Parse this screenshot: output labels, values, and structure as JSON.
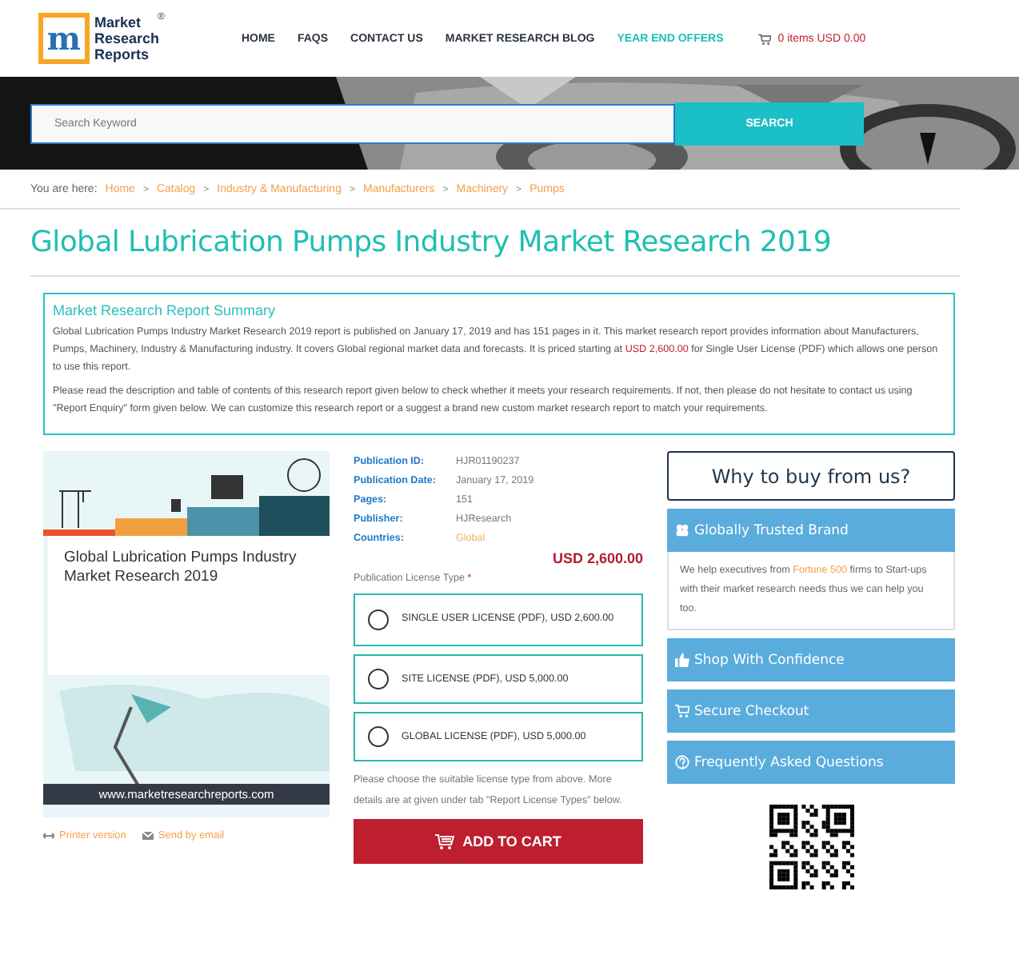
{
  "logo": {
    "letter": "m",
    "lines": [
      "Market",
      "Research",
      "Reports"
    ],
    "mark": "®"
  },
  "nav": [
    {
      "label": "HOME",
      "kind": "plain"
    },
    {
      "label": "FAQS",
      "kind": "plain"
    },
    {
      "label": "CONTACT US",
      "kind": "plain"
    },
    {
      "label": "MARKET RESEARCH BLOG",
      "kind": "plain"
    },
    {
      "label": "YEAR END OFFERS",
      "kind": "offer"
    }
  ],
  "cart": {
    "label": "0 items USD 0.00"
  },
  "search": {
    "placeholder": "Search Keyword",
    "button": "SEARCH"
  },
  "breadcrumb": {
    "prefix": "You are here:",
    "items": [
      "Home",
      "Catalog",
      "Industry & Manufacturing",
      "Manufacturers",
      "Machinery",
      "Pumps"
    ],
    "separator": ">"
  },
  "title": "Global Lubrication Pumps Industry Market Research 2019",
  "summary": {
    "heading": "Market Research Report Summary",
    "paragraphs": [
      [
        {
          "text": "Global Lubrication Pumps Industry Market Research 2019 report is published on January 17, 2019 and has 151 pages in it. This market research report provides information about Manufacturers, Pumps, Machinery, Industry & Manufacturing industry. It covers Global regional market data and forecasts. It is priced starting at ",
          "kind": "plain"
        },
        {
          "text": "USD 2,600.00",
          "kind": "price"
        },
        {
          "text": " for Single User License (PDF) which allows one person to use this report.",
          "kind": "plain"
        }
      ],
      [
        {
          "text": "Please read the description and table of contents of this research report given below to check whether it meets your research requirements. If not, then please do not hesitate to contact us using \"Report Enquiry\" form given below. We can customize this research report or a suggest a brand new custom market research report to match your requirements.",
          "kind": "plain"
        }
      ]
    ]
  },
  "cover": {
    "title": "Global Lubrication Pumps Industry Market Research 2019",
    "url": "www.marketresearchreports.com"
  },
  "links": [
    {
      "label": "Printer version",
      "kind": "print"
    },
    {
      "label": "Send by email",
      "kind": "email"
    }
  ],
  "details": [
    {
      "label": "Publication ID:",
      "value": "HJR01190237",
      "kind": "plain"
    },
    {
      "label": "Publication Date:",
      "value": "January 17, 2019",
      "kind": "plain"
    },
    {
      "label": "Pages:",
      "value": "151",
      "kind": "plain"
    },
    {
      "label": "Publisher:",
      "value": "HJResearch",
      "kind": "plain"
    },
    {
      "label": "Countries:",
      "value": "Global",
      "kind": "link"
    }
  ],
  "price": "USD 2,600.00",
  "license_label": "Publication License Type",
  "required_mark": "*",
  "licenses": [
    {
      "label": "SINGLE USER LICENSE (PDF), USD 2,600.00",
      "selected": false
    },
    {
      "label": "SITE LICENSE (PDF), USD 5,000.00",
      "selected": false
    },
    {
      "label": "GLOBAL LICENSE (PDF), USD 5,000.00",
      "selected": false
    }
  ],
  "license_note": "Please choose the suitable license type from above. More details are at given under tab \"Report License Types\" below.",
  "add_to_cart": "ADD TO CART",
  "why": {
    "heading": "Why to buy from us?",
    "items": [
      {
        "label": "Globally Trusted Brand",
        "kind": "brand",
        "body": [
          {
            "text": "We help executives from ",
            "kind": "plain"
          },
          {
            "text": "Fortune 500",
            "kind": "link"
          },
          {
            "text": " firms to Start-ups with their market research needs thus we can help you too.",
            "kind": "plain"
          }
        ]
      },
      {
        "label": "Shop With Confidence",
        "kind": "confidence"
      },
      {
        "label": "Secure Checkout",
        "kind": "checkout"
      },
      {
        "label": "Frequently Asked Questions",
        "kind": "faq"
      }
    ]
  }
}
